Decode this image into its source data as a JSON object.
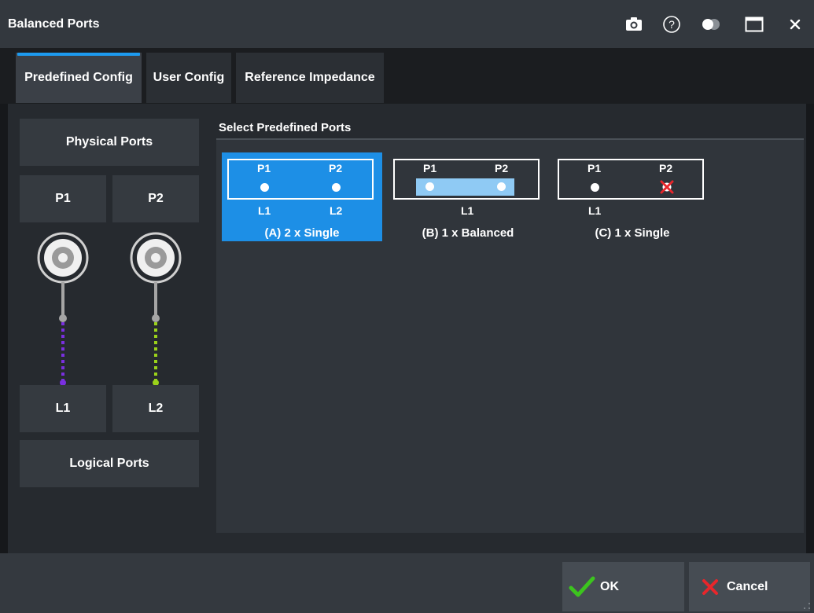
{
  "window": {
    "title": "Balanced Ports"
  },
  "titlebar_icons": [
    "camera-icon",
    "help-icon",
    "toggle-icon",
    "maximize-icon",
    "close-icon"
  ],
  "tabs": [
    {
      "label": "Predefined Config",
      "active": true
    },
    {
      "label": "User Config",
      "active": false
    },
    {
      "label": "Reference Impedance",
      "active": false
    }
  ],
  "left_panel": {
    "physical_ports_label": "Physical Ports",
    "logical_ports_label": "Logical Ports",
    "physical": [
      "P1",
      "P2"
    ],
    "logical": [
      "L1",
      "L2"
    ],
    "line_colors": {
      "p1": "#7a2fe0",
      "p2": "#9ad21a"
    }
  },
  "predefined": {
    "group_label": "Select Predefined Ports",
    "options": [
      {
        "caption": "(A) 2 x Single",
        "top_left": "P1",
        "top_right": "P2",
        "bottom_left": "L1",
        "bottom_right": "L2",
        "selected": true
      },
      {
        "caption": "(B) 1 x Balanced",
        "top_left": "P1",
        "top_right": "P2",
        "bottom_center": "L1",
        "selected": false
      },
      {
        "caption": "(C) 1 x Single",
        "top_left": "P1",
        "top_right": "P2",
        "bottom_left": "L1",
        "selected": false
      }
    ]
  },
  "footer": {
    "ok_label": "OK",
    "cancel_label": "Cancel"
  },
  "colors": {
    "accent": "#1d9bf0",
    "selected_bg": "#1d8fe6",
    "ok_check": "#3cc41e",
    "cancel_x": "#e8262b"
  }
}
